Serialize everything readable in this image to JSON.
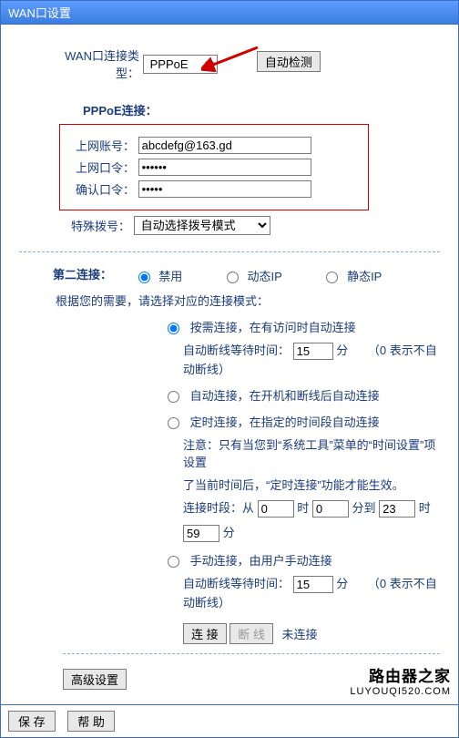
{
  "titlebar": "WAN口设置",
  "conn_type": {
    "label": "WAN口连接类型：",
    "options": [
      "PPPoE"
    ],
    "value": "PPPoE"
  },
  "auto_detect": "自动检测",
  "pppoe_section": "PPPoE连接：",
  "creds": {
    "user_label": "上网账号：",
    "user_value": "abcdefg@163.gd",
    "pass_label": "上网口令：",
    "pass_value": "••••••",
    "confirm_label": "确认口令：",
    "confirm_value": "•••••"
  },
  "special_dial": {
    "label": "特殊拨号：",
    "options": [
      "自动选择拨号模式"
    ],
    "value": "自动选择拨号模式"
  },
  "second_conn": {
    "title": "第二连接：",
    "opts": {
      "disable": "禁用",
      "dynamic": "动态IP",
      "static": "静态IP"
    },
    "selected": "disable",
    "hint": "根据您的需要，请选择对应的连接模式："
  },
  "modes": {
    "on_demand": {
      "label": "按需连接，在有访问时自动连接",
      "wait_label": "自动断线等待时间：",
      "wait_value": "15",
      "unit": "分",
      "note": "（0 表示不自动断线）"
    },
    "auto": {
      "label": "自动连接，在开机和断线后自动连接"
    },
    "schedule": {
      "label": "定时连接，在指定的时间段自动连接",
      "note1": "注意：只有当您到“系统工具”菜单的“时间设置”项设置",
      "note2": "了当前时间后，“定时连接”功能才能生效。",
      "time_label": "连接时段：从",
      "h1": "0",
      "m1": "0",
      "to": "时",
      "m_unit": "分",
      "mid": "分到",
      "h2": "23",
      "m2": "59"
    },
    "manual": {
      "label": "手动连接，由用户手动连接",
      "wait_label": "自动断线等待时间：",
      "wait_value": "15",
      "unit": "分",
      "note": "（0 表示不自动断线）"
    },
    "selected": "on_demand"
  },
  "conn_buttons": {
    "connect": "连 接",
    "disconnect": "断 线",
    "status": "未连接"
  },
  "advanced": "高级设置",
  "footer": {
    "save": "保 存",
    "help": "帮 助"
  },
  "watermark": {
    "big": "路由器之家",
    "small": "LUYOUQI520.COM"
  }
}
